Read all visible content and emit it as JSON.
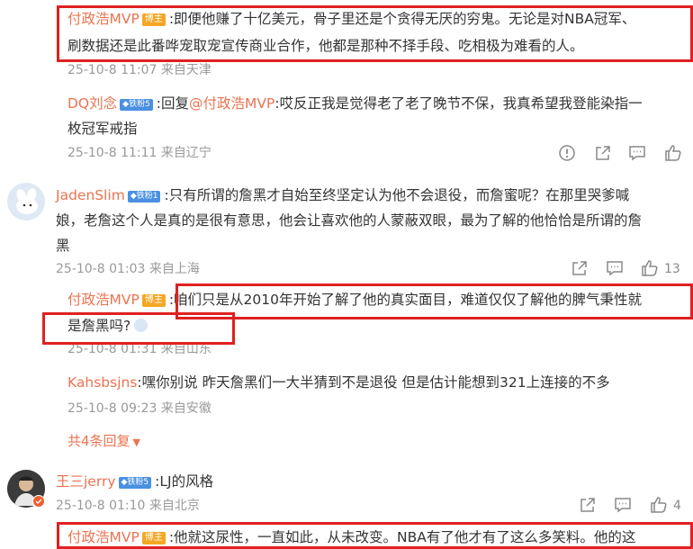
{
  "comments": {
    "c1": {
      "name": "付政浩MVP",
      "badge": "博主",
      "text_line1": ":即便他赚了十亿美元，骨子里还是个贪得无厌的穷鬼。无论是对NBA冠军、",
      "text_line2": "刷数据还是此番哗宠取宠宣传商业合作，他都是那种不择手段、吃相极为难看的人。",
      "meta": "25-10-8 11:07 来自天津"
    },
    "c2": {
      "name": "DQ刘念",
      "badge": "铁粉5",
      "reply_prefix": ":回复",
      "mention": "@付政浩MVP",
      "text_line1": ":哎反正我是觉得老了老了晚节不保，我真希望我登能染指一",
      "text_line2": "枚冠军戒指",
      "meta": "25-10-8 11:11 来自辽宁"
    },
    "c3": {
      "name": "JadenSlim",
      "badge": "铁粉1",
      "text_line1": ":只有所谓的詹黑才自始至终坚定认为他不会退役，而詹蜜呢？在那里哭爹喊",
      "text_line2": "娘，老詹这个人是真的是很有意思，他会让喜欢他的人蒙蔽双眼，最为了解的他恰恰是所谓的詹",
      "text_line3": "黑",
      "meta": "25-10-8 01:03 来自上海",
      "likes": "13"
    },
    "c4": {
      "name": "付政浩MVP",
      "badge": "博主",
      "text_line1": ":咱们只是从2010年开始了解了他的真实面目，难道仅仅了解他的脾气秉性就",
      "text_line2": "是詹黑吗?",
      "meta": "25-10-8 01:31 来自山东"
    },
    "c5": {
      "name": "Kahsbsjns",
      "text": ":嘿你别说 昨天詹黑们一大半猜到不是退役 但是估计能想到321上连接的不多",
      "meta": "25-10-8 09:23 来自安徽"
    },
    "more_replies": "共4条回复",
    "c6": {
      "name": "王三jerry",
      "badge": "铁粉5",
      "text": ":LJ的风格",
      "meta": "25-10-8 01:10 来自北京",
      "likes": "4"
    },
    "c7": {
      "name": "付政浩MVP",
      "badge": "博主",
      "text": ":他就这尿性，一直如此，从未改变。NBA有了他才有了这么多笑料。他的这"
    }
  },
  "icons": {
    "report": "report-icon",
    "share": "share-icon",
    "comment": "comment-icon",
    "like": "thumbs-up-icon"
  },
  "colors": {
    "name_orange": "#eb7350",
    "meta_gray": "#999999",
    "highlight_red": "#e02020",
    "badge_orange": "#f5a623",
    "badge_blue": "#4a90e2"
  }
}
